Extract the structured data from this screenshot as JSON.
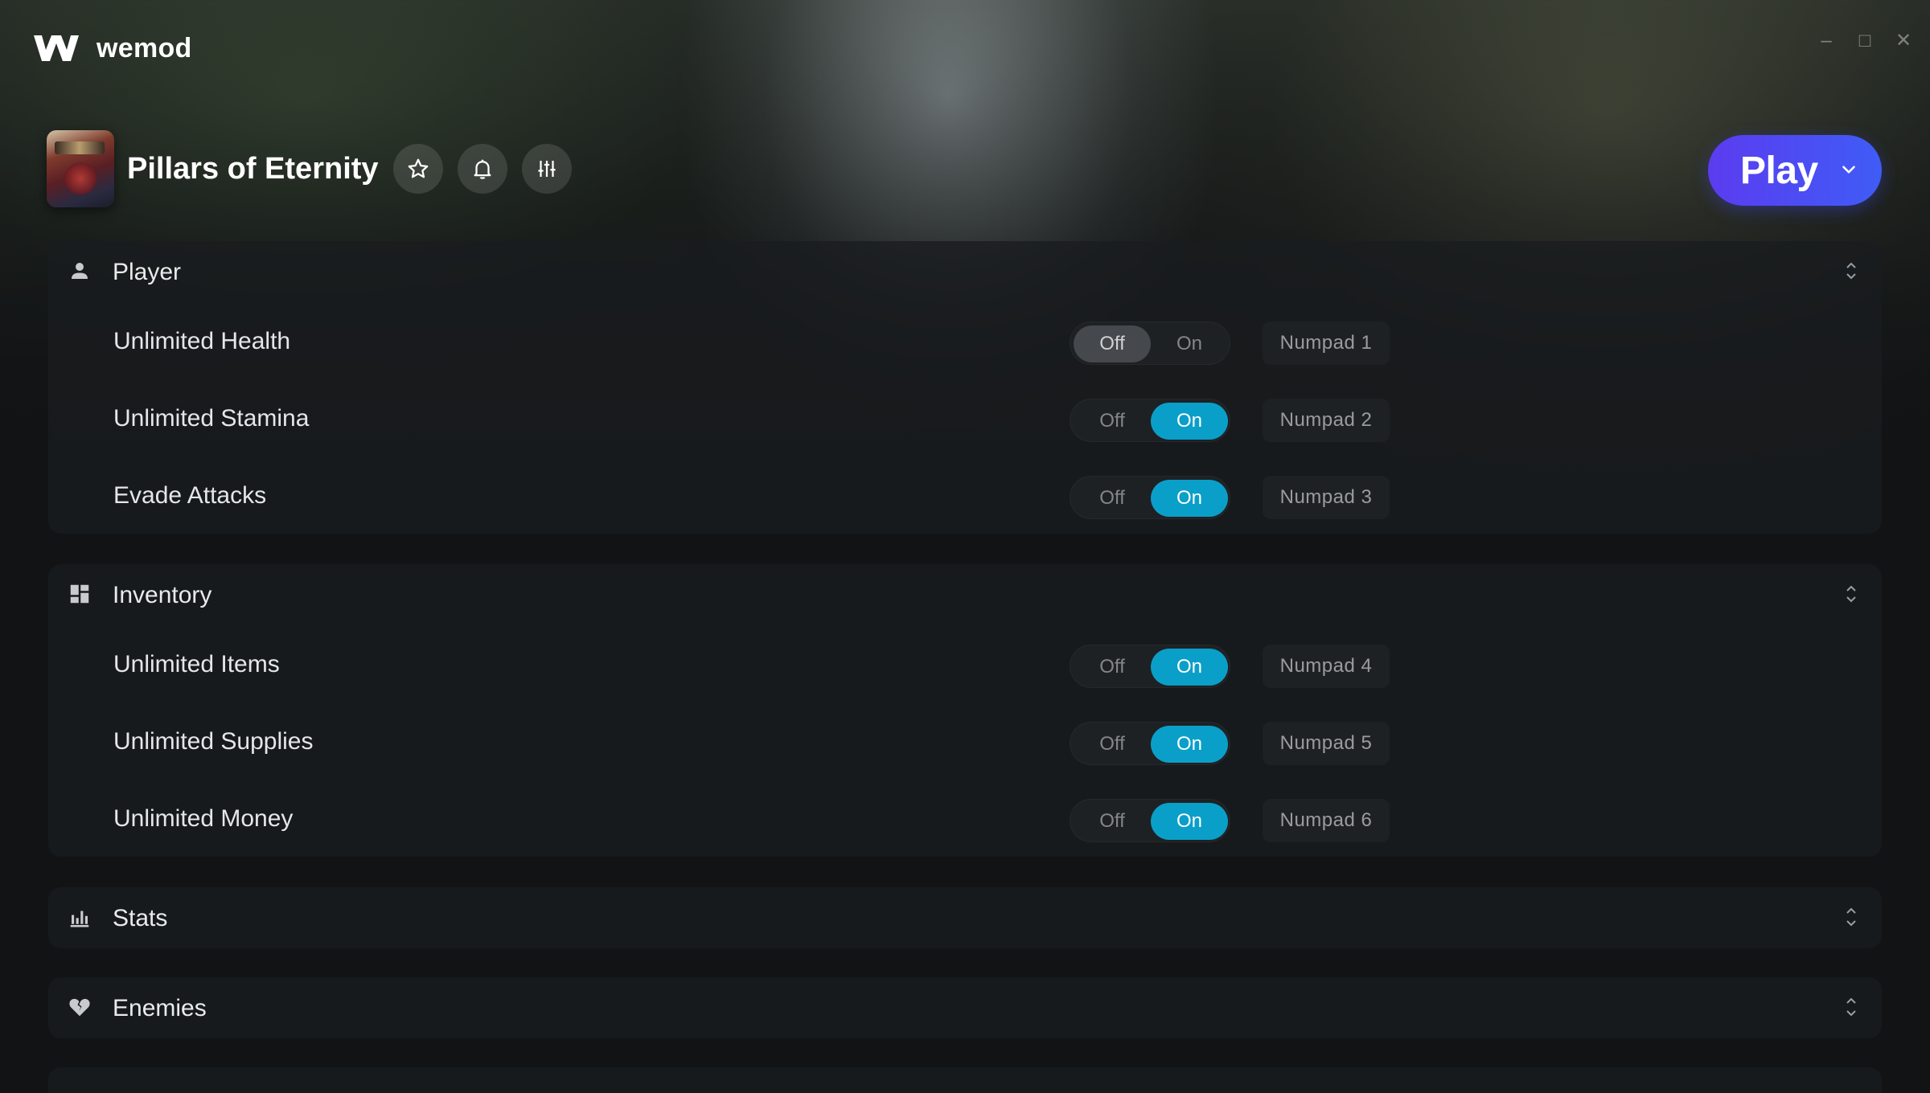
{
  "app": {
    "name": "wemod"
  },
  "window_controls": {
    "minimize": "–",
    "maximize": "□",
    "close": "✕"
  },
  "game": {
    "title": "Pillars of Eternity",
    "actions": [
      "star-icon",
      "bell-icon",
      "sliders-icon"
    ]
  },
  "play_button": {
    "label": "Play"
  },
  "colors": {
    "toggle_on": "#0a9fc8",
    "play_start": "#5b3cf0",
    "play_end": "#3f5cf6"
  },
  "sections": [
    {
      "title": "Player",
      "icon": "person-icon",
      "expanded": true,
      "rows": [
        {
          "name": "Unlimited Health",
          "state": "Off",
          "off_label": "Off",
          "on_label": "On",
          "hotkey": "Numpad 1"
        },
        {
          "name": "Unlimited Stamina",
          "state": "On",
          "off_label": "Off",
          "on_label": "On",
          "hotkey": "Numpad 2"
        },
        {
          "name": "Evade Attacks",
          "state": "On",
          "off_label": "Off",
          "on_label": "On",
          "hotkey": "Numpad 3"
        }
      ]
    },
    {
      "title": "Inventory",
      "icon": "grid-icon",
      "expanded": true,
      "rows": [
        {
          "name": "Unlimited Items",
          "state": "On",
          "off_label": "Off",
          "on_label": "On",
          "hotkey": "Numpad 4"
        },
        {
          "name": "Unlimited Supplies",
          "state": "On",
          "off_label": "Off",
          "on_label": "On",
          "hotkey": "Numpad 5"
        },
        {
          "name": "Unlimited Money",
          "state": "On",
          "off_label": "Off",
          "on_label": "On",
          "hotkey": "Numpad 6"
        }
      ]
    },
    {
      "title": "Stats",
      "icon": "bar-chart-icon",
      "expanded": false,
      "rows": []
    },
    {
      "title": "Enemies",
      "icon": "broken-heart-icon",
      "expanded": false,
      "rows": []
    }
  ]
}
